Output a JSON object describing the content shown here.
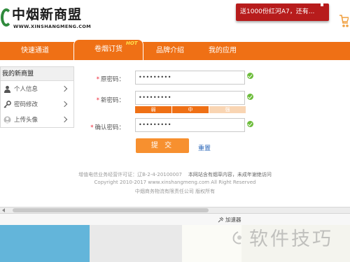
{
  "header": {
    "logo_title": "中烟新商盟",
    "logo_url": "WWW.XINSHANGMENG.COM",
    "promo_text": "送1000份红河A7，还有...",
    "icons": {
      "cart": "cart-icon",
      "logo": "logo-mark-icon"
    },
    "colors": {
      "brand_orange": "#ef7015",
      "promo_red": "#b71c1c",
      "logo_green": "#2f8a3c"
    }
  },
  "nav": {
    "items": [
      {
        "label": "快速通道"
      },
      {
        "label": "卷烟订货",
        "active": true,
        "badge": "HOT"
      },
      {
        "label": "品牌介绍"
      },
      {
        "label": "我的应用"
      }
    ]
  },
  "sidebar": {
    "title": "我的新商盟",
    "items": [
      {
        "label": "个人信息",
        "icon": "person-icon"
      },
      {
        "label": "密码修改",
        "icon": "key-icon"
      },
      {
        "label": "上传头像",
        "icon": "avatar-icon"
      }
    ]
  },
  "form": {
    "old_password": {
      "label": "原密码：",
      "value": "•••••••••"
    },
    "new_password": {
      "label": "新密码：",
      "value": "•••••••••"
    },
    "confirm_password": {
      "label": "确认密码：",
      "value": "•••••••••"
    },
    "strength": {
      "weak": "弱",
      "medium": "中",
      "strong": "强"
    },
    "submit_label": "提 交",
    "reset_label": "重置",
    "colors": {
      "submit": "#f7902f",
      "check": "#6cbc3a"
    }
  },
  "footer": {
    "license": "增值电信业务经营许可证：辽B-2-4-20100007",
    "notice": "本网站含有烟草内容，未成年谢绝访问",
    "copyright": "Copyright 2010-2017 www.xinshangmeng.com All Right Reserved",
    "company": "中烟商务物流有限责任公司 版权所有"
  },
  "bottom_bar": {
    "pin_label": "加速器",
    "watermark": "软件技巧"
  }
}
